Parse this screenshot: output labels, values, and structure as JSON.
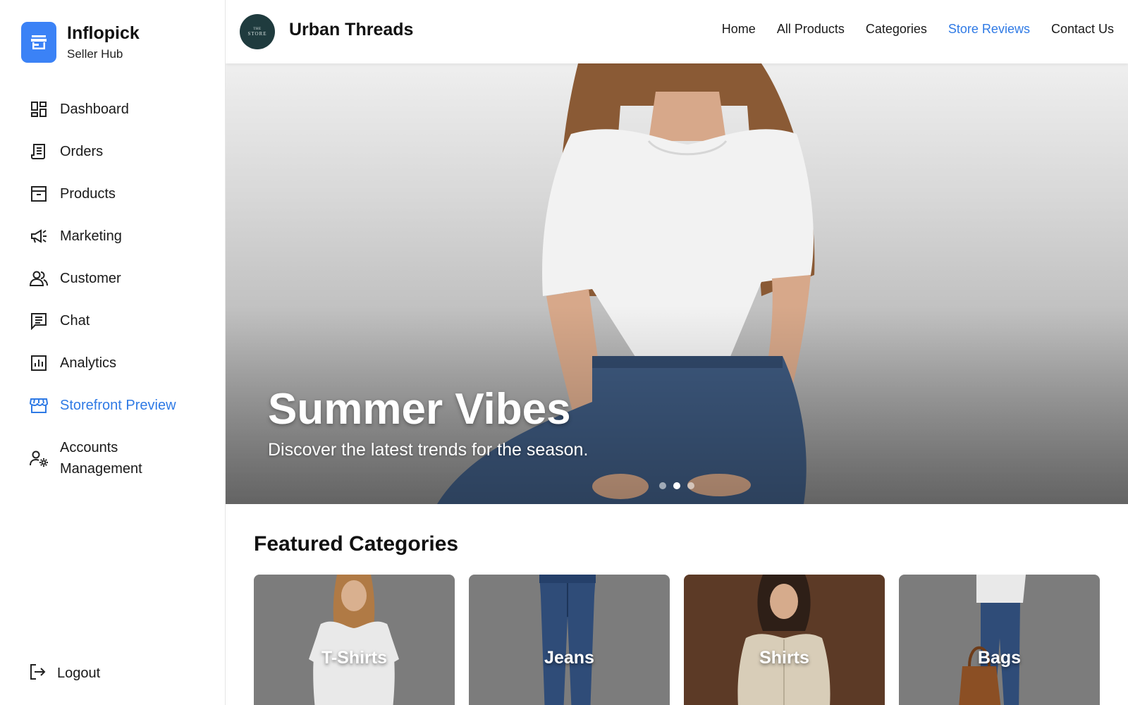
{
  "brand": {
    "name": "Inflopick",
    "subtitle": "Seller Hub",
    "accent": "#3b82f6"
  },
  "sidebar": {
    "items": [
      {
        "label": "Dashboard",
        "icon": "dashboard-icon"
      },
      {
        "label": "Orders",
        "icon": "receipt-icon"
      },
      {
        "label": "Products",
        "icon": "archive-box-icon"
      },
      {
        "label": "Marketing",
        "icon": "megaphone-icon"
      },
      {
        "label": "Customer",
        "icon": "users-icon"
      },
      {
        "label": "Chat",
        "icon": "chat-icon"
      },
      {
        "label": "Analytics",
        "icon": "analytics-icon"
      },
      {
        "label": "Storefront Preview",
        "icon": "storefront-icon",
        "active": true
      },
      {
        "label": "Accounts Management",
        "icon": "user-gear-icon"
      }
    ],
    "logout_label": "Logout",
    "active_color": "#2f7ae5"
  },
  "store": {
    "name": "Urban Threads",
    "logo_text_top": "THE",
    "logo_text_main": "STORE",
    "nav": [
      {
        "label": "Home"
      },
      {
        "label": "All Products"
      },
      {
        "label": "Categories"
      },
      {
        "label": "Store Reviews",
        "active": true
      },
      {
        "label": "Contact Us"
      }
    ]
  },
  "hero": {
    "title": "Summer Vibes",
    "subtitle": "Discover the latest trends for the season.",
    "slides": 3,
    "active_slide": 2
  },
  "featured": {
    "title": "Featured Categories",
    "categories": [
      {
        "label": "T-Shirts"
      },
      {
        "label": "Jeans"
      },
      {
        "label": "Shirts"
      },
      {
        "label": "Bags"
      }
    ]
  }
}
